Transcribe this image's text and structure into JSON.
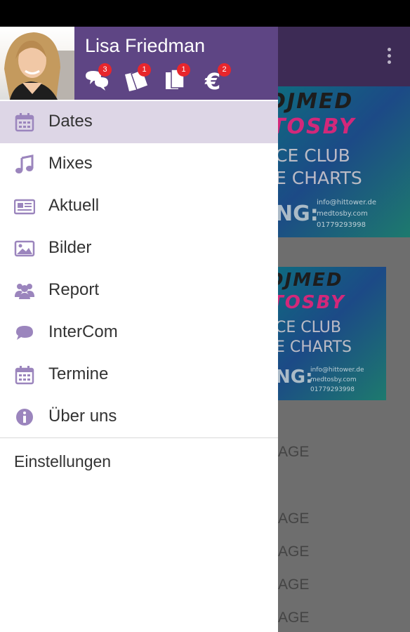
{
  "user": {
    "name": "Lisa Friedman"
  },
  "header_icons": [
    {
      "icon": "chat-bubbles-icon",
      "badge": "3"
    },
    {
      "icon": "tickets-icon",
      "badge": "1"
    },
    {
      "icon": "documents-icon",
      "badge": "1"
    },
    {
      "icon": "euro-icon",
      "badge": "2"
    }
  ],
  "menu": [
    {
      "label": "Dates",
      "icon": "calendar-icon",
      "active": true
    },
    {
      "label": "Mixes",
      "icon": "music-note-icon"
    },
    {
      "label": "Aktuell",
      "icon": "newspaper-icon"
    },
    {
      "label": "Bilder",
      "icon": "image-icon"
    },
    {
      "label": "Report",
      "icon": "group-icon"
    },
    {
      "label": "InterCom",
      "icon": "speech-bubble-icon"
    },
    {
      "label": "Termine",
      "icon": "calendar-icon"
    },
    {
      "label": "Über uns",
      "icon": "info-icon"
    }
  ],
  "settings_label": "Einstellungen",
  "background": {
    "banner1": {
      "line1": "DJMED",
      "line2": "TOSBY",
      "line3": "CE CLUB",
      "line4": "E CHARTS",
      "line5": "NG:",
      "contact1": "info@hittower.de",
      "contact2": "medtosby.com",
      "contact3": "01779293998"
    },
    "banner2": {
      "line1": "DJMED",
      "line2": "TOSBY",
      "line3": "CE CLUB",
      "line4": "E CHARTS",
      "line5": "NG:",
      "contact1": "info@hittower.de",
      "contact2": "medtosby.com",
      "contact3": "01779293998"
    },
    "rows": [
      "AGE",
      "AGE",
      "AGE",
      "AGE",
      "AGE"
    ]
  },
  "colors": {
    "header": "#5e4584",
    "active_row": "#ddd6e6",
    "icon": "#9b85bd",
    "badge": "#e8262c"
  }
}
